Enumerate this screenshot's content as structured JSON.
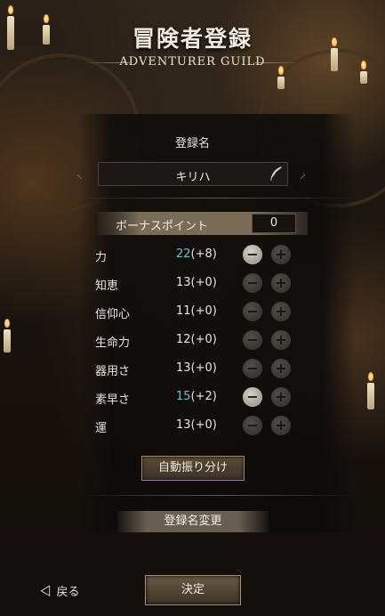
{
  "header": {
    "title": "冒険者登録",
    "subtitle": "ADVENTURER GUILD"
  },
  "registration": {
    "name_label": "登録名",
    "name_value": "キリハ",
    "bonus_label": "ボーナスポイント",
    "bonus_value": "0"
  },
  "stats": [
    {
      "name": "力",
      "base": "22",
      "mod": "(+8)",
      "boosted": true
    },
    {
      "name": "知恵",
      "base": "13",
      "mod": "(+0)",
      "boosted": false
    },
    {
      "name": "信仰心",
      "base": "11",
      "mod": "(+0)",
      "boosted": false
    },
    {
      "name": "生命力",
      "base": "12",
      "mod": "(+0)",
      "boosted": false
    },
    {
      "name": "器用さ",
      "base": "13",
      "mod": "(+0)",
      "boosted": false
    },
    {
      "name": "素早さ",
      "base": "15",
      "mod": "(+2)",
      "boosted": true
    },
    {
      "name": "運",
      "base": "13",
      "mod": "(+0)",
      "boosted": false
    }
  ],
  "buttons": {
    "minus": "−",
    "plus": "+",
    "auto_assign": "自動振り分け",
    "rename": "登録名変更",
    "back": "戻る",
    "confirm": "決定"
  },
  "colors": {
    "boosted_value": "#5ec8d8",
    "accent_gold": "#a38f6c"
  },
  "icons": {
    "quill": "quill-icon",
    "back": "back-arrow-icon"
  }
}
